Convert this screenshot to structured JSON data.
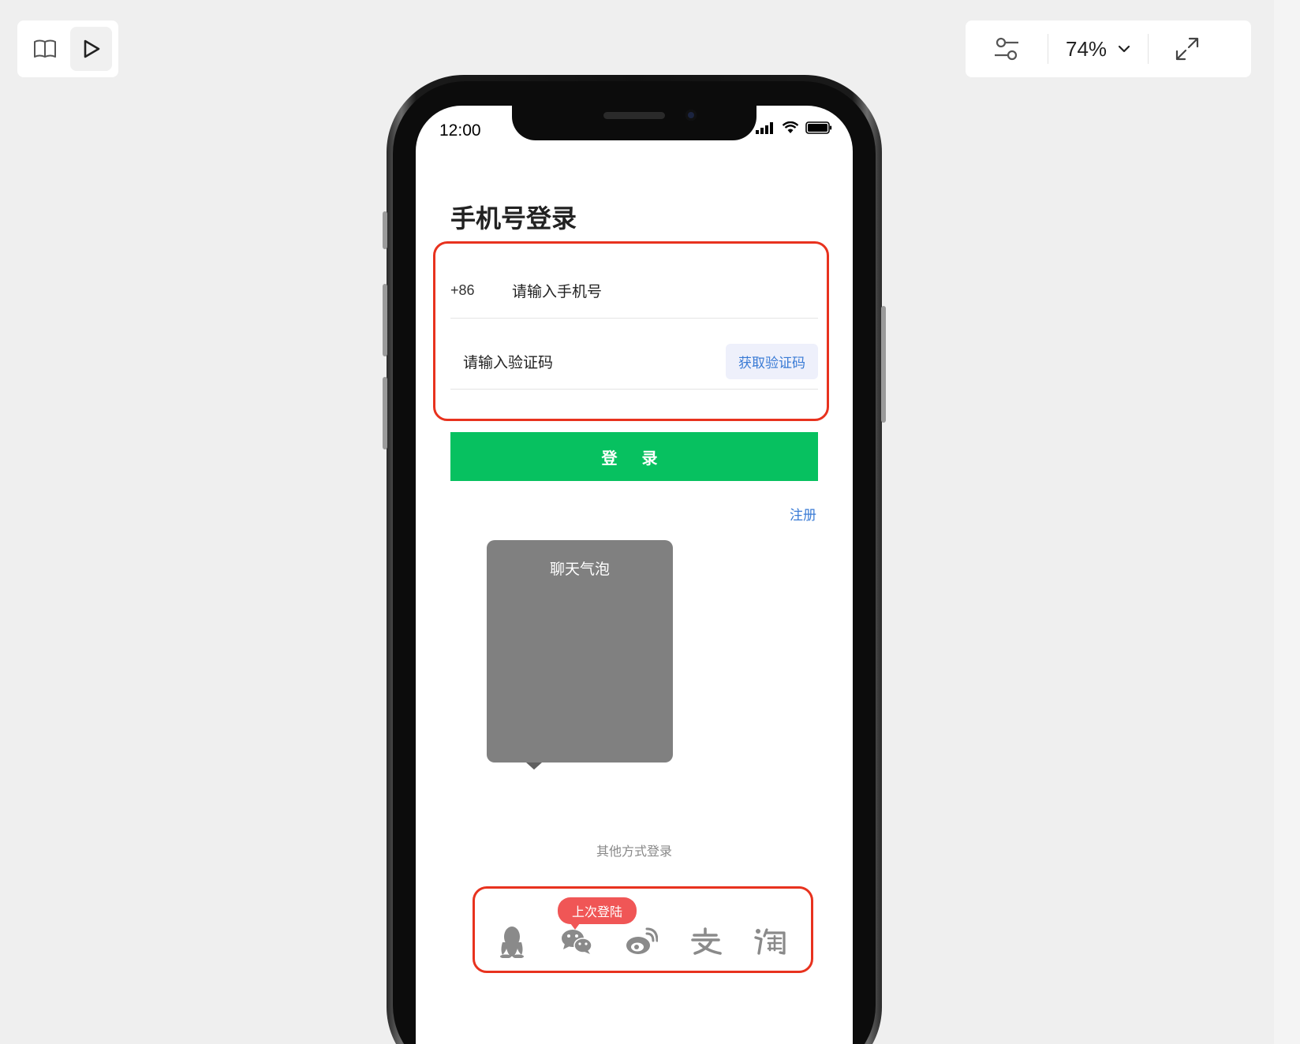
{
  "toolbar_left": {
    "book_icon": "book-icon",
    "play_icon": "play-icon"
  },
  "toolbar_right": {
    "settings_icon": "sliders-icon",
    "zoom": "74%",
    "zoom_dropdown_icon": "chevron-down-icon",
    "fullscreen_icon": "expand-icon"
  },
  "status_bar": {
    "time": "12:00"
  },
  "login": {
    "title": "手机号登录",
    "country_code": "+86",
    "phone_placeholder": "请输入手机号",
    "code_placeholder": "请输入验证码",
    "get_code_label": "获取验证码",
    "login_button": "登 录",
    "register_link": "注册"
  },
  "bubble": {
    "title": "聊天气泡"
  },
  "other_login": {
    "label": "其他方式登录",
    "last_badge": "上次登陆",
    "providers": [
      {
        "name": "qq",
        "icon": "qq-penguin-icon"
      },
      {
        "name": "wechat",
        "icon": "wechat-icon"
      },
      {
        "name": "weibo",
        "icon": "weibo-icon"
      },
      {
        "name": "alipay",
        "icon": "alipay-icon"
      },
      {
        "name": "taobao",
        "icon": "taobao-icon"
      }
    ]
  },
  "colors": {
    "accent_green": "#07c160",
    "link_blue": "#3a7bd5",
    "annotation_red": "#e8321e",
    "badge_red": "#f05656"
  }
}
